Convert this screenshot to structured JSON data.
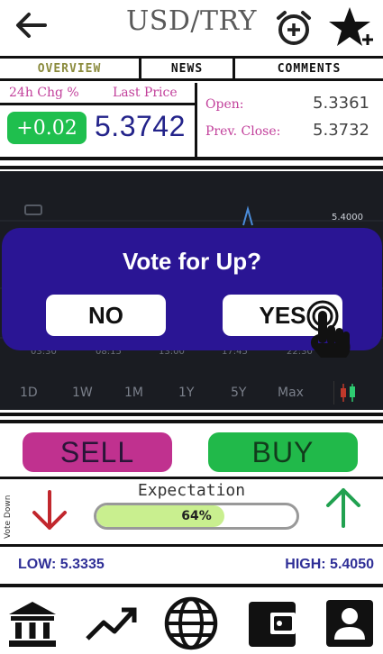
{
  "header": {
    "title": "USD/TRY"
  },
  "tabs": [
    {
      "label": "OVERVIEW"
    },
    {
      "label": "NEWS"
    },
    {
      "label": "COMMENTS"
    }
  ],
  "price": {
    "chg_label": "24h Chg %",
    "last_label": "Last Price",
    "chg_value": "+0.02",
    "last_value": "5.3742",
    "open_label": "Open:",
    "open_value": "5.3361",
    "prev_close_label": "Prev. Close:",
    "prev_close_value": "5.3732"
  },
  "chart": {
    "price_label": "5.4000",
    "time_labels": [
      "03:30",
      "08:15",
      "13:00",
      "17:45",
      "22:30"
    ],
    "ranges": [
      "1D",
      "1W",
      "1M",
      "1Y",
      "5Y",
      "Max"
    ]
  },
  "modal": {
    "title": "Vote for Up?",
    "no_label": "NO",
    "yes_label": "YES"
  },
  "trade": {
    "sell_label": "SELL",
    "buy_label": "BUY"
  },
  "expectation": {
    "title": "Expectation",
    "vote_down_label": "Vote Down",
    "percent_label": "64%",
    "percent_value": 0.64
  },
  "range_stats": {
    "low": "LOW: 5.3335",
    "high": "HIGH: 5.4050"
  },
  "colors": {
    "accent_blue": "#2a1594",
    "buy_green": "#21b94a",
    "sell_magenta": "#c0318f",
    "label_pink": "#c2409b"
  },
  "nav": {
    "items": [
      "bank-icon",
      "trend-icon",
      "globe-icon",
      "wallet-icon",
      "profile-icon"
    ]
  }
}
